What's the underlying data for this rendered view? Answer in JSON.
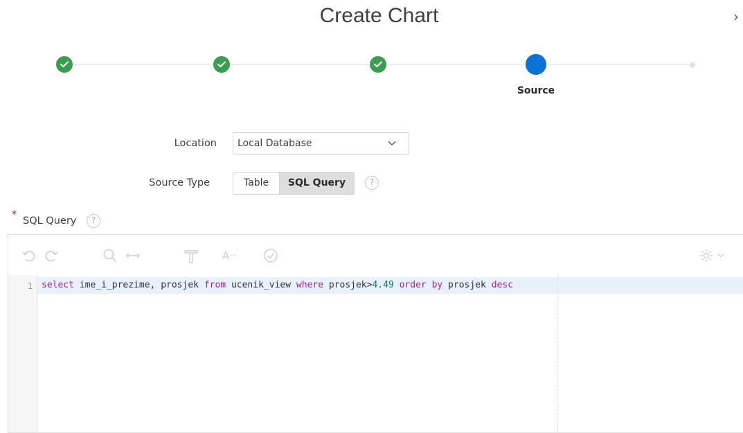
{
  "dialog": {
    "title": "Create Chart",
    "close_label": "›"
  },
  "wizard": {
    "steps": [
      {
        "state": "complete"
      },
      {
        "state": "complete"
      },
      {
        "state": "complete"
      },
      {
        "state": "current",
        "label": "Source"
      },
      {
        "state": "future"
      }
    ]
  },
  "form": {
    "location": {
      "label": "Location",
      "value": "Local Database"
    },
    "source_type": {
      "label": "Source Type",
      "options": [
        "Table",
        "SQL Query"
      ],
      "selected": "SQL Query"
    },
    "sql_query": {
      "label": "SQL Query",
      "required": true
    }
  },
  "editor": {
    "toolbar": [
      "undo-icon",
      "redo-icon",
      "search-icon",
      "replace-icon",
      "format-icon",
      "autocomplete-icon",
      "validate-icon",
      "settings-icon"
    ],
    "lines": [
      {
        "number": "1",
        "tokens": [
          {
            "text": "select",
            "kind": "kw"
          },
          {
            "text": " ime_i_prezime, prosjek ",
            "kind": "text"
          },
          {
            "text": "from",
            "kind": "kw"
          },
          {
            "text": " ucenik_view ",
            "kind": "text"
          },
          {
            "text": "where",
            "kind": "kw"
          },
          {
            "text": " prosjek>",
            "kind": "text"
          },
          {
            "text": "4.49",
            "kind": "num"
          },
          {
            "text": " ",
            "kind": "text"
          },
          {
            "text": "order by",
            "kind": "kw"
          },
          {
            "text": " prosjek ",
            "kind": "text"
          },
          {
            "text": "desc",
            "kind": "kw"
          }
        ]
      }
    ]
  },
  "colors": {
    "complete": "#3a9e50",
    "current": "#0c72d6",
    "keyword": "#a01ea0",
    "number": "#0a7a6a"
  }
}
